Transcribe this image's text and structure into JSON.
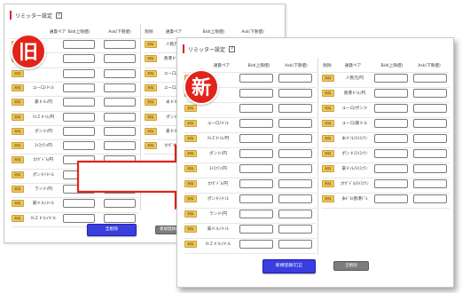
{
  "old_panel": {
    "title": "リミッター設定",
    "help": "?",
    "badge": "旧",
    "headers": {
      "pair": "通貨ペア",
      "bid": "Bid(上限値)",
      "ask": "Ask(下限値)"
    },
    "delete_label": "削除",
    "rows": [
      "",
      "",
      "",
      "ユーロ/ドル",
      "豪ドル/円",
      "ＮＺドル/円",
      "ポンド/円",
      "ｽｲｽﾌﾗﾝ/円",
      "ｶﾅﾀﾞﾄﾞﾙ/円",
      "ポンド/ドル",
      "ランド/円",
      "豪ドル/ドル",
      "ＮＺドル/ドル"
    ],
    "right_headers": {
      "pair": "通貨ペア",
      "bid": "Bid(上限値)",
      "ask": "Ask(下限値)"
    },
    "right_rows": [
      "人民元/円",
      "香港ドル/円",
      "ユーロ/ポン",
      "ユーロ/豪ド",
      "米ドル/ｽｲ",
      "ポンド/ｽｲ",
      "豪ドル/ｽｲ",
      "ｶﾅﾀﾞﾄﾞﾙ/ｽｲ"
    ],
    "buttons": {
      "delete_all": "全削除",
      "register": "新規登録/訂"
    }
  },
  "new_panel": {
    "title": "リミッター設定",
    "help": "?",
    "badge": "新",
    "headers": {
      "pair": "通貨ペア",
      "bid": "Bid(上限値)",
      "ask": "Ask(下限値)"
    },
    "delete_label": "削除",
    "left_rows": [
      "",
      "",
      "",
      "ユーロ/ドル",
      "ＮＺドル/円",
      "ポンド/円",
      "ｽｲｽﾌﾗﾝ/円",
      "ｶﾅﾀﾞﾄﾞﾙ/円",
      "ポンド/ドル",
      "ランド/円",
      "豪ドル/ドル",
      "ＮＺドル/ドル"
    ],
    "right_rows": [
      "人民元/円",
      "香港ドル/円",
      "ユーロ/ポンド",
      "ユーロ/豪ドル",
      "米ドル/ｽｲｽﾌﾗﾝ",
      "ポンド/ｽｲｽﾌﾗﾝ",
      "豪ドル/ｽｲｽﾌﾗﾝ",
      "ｶﾅﾀﾞﾄﾞﾙ/ｽｲｽﾌﾗﾝ",
      "米ﾄﾞﾙ/香港ﾄﾞﾙ"
    ],
    "buttons": {
      "register": "新規登録/訂正",
      "delete_all": "全削除"
    }
  },
  "colors": {
    "accent": "#e01d2c",
    "badge": "#e2231a",
    "delete_btn": "#f2c75b",
    "primary_btn": "#3a3ee0",
    "secondary_btn": "#7d7d7d"
  }
}
